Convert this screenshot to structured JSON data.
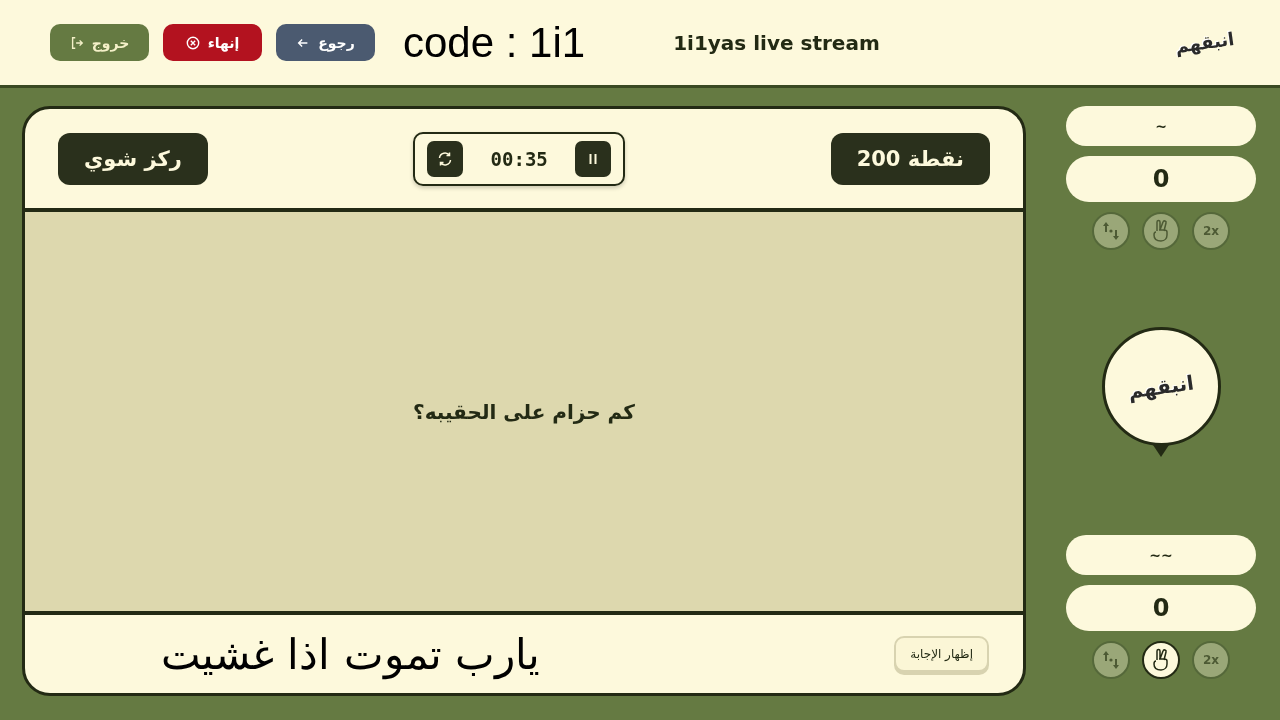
{
  "header": {
    "buttons": [
      {
        "kind": "back",
        "label": "رجوع"
      },
      {
        "kind": "end",
        "label": "إنهاء"
      },
      {
        "kind": "exit",
        "label": "خروج"
      }
    ],
    "code": "code : 1i1",
    "title": "1i1yas live stream",
    "logo": "انبقهم"
  },
  "card": {
    "hint": "ركز شوي",
    "timer": "00:35",
    "points": "200 نقطة",
    "question": "كم حزام على الحقيبه؟",
    "answer": "يارب تموت اذا غشيت",
    "show_answer": "إظهار الإجابة"
  },
  "teams": [
    {
      "name": "~",
      "score": "0",
      "lifelines": [
        {
          "kind": "swap",
          "active": false
        },
        {
          "kind": "hand",
          "active": false
        },
        {
          "kind": "double",
          "label": "2x",
          "active": false
        }
      ]
    },
    {
      "name": "~~",
      "score": "0",
      "lifelines": [
        {
          "kind": "swap",
          "active": false
        },
        {
          "kind": "hand",
          "active": true
        },
        {
          "kind": "double",
          "label": "2x",
          "active": false
        }
      ]
    }
  ],
  "bubble": {
    "logo": "انبقهم"
  }
}
